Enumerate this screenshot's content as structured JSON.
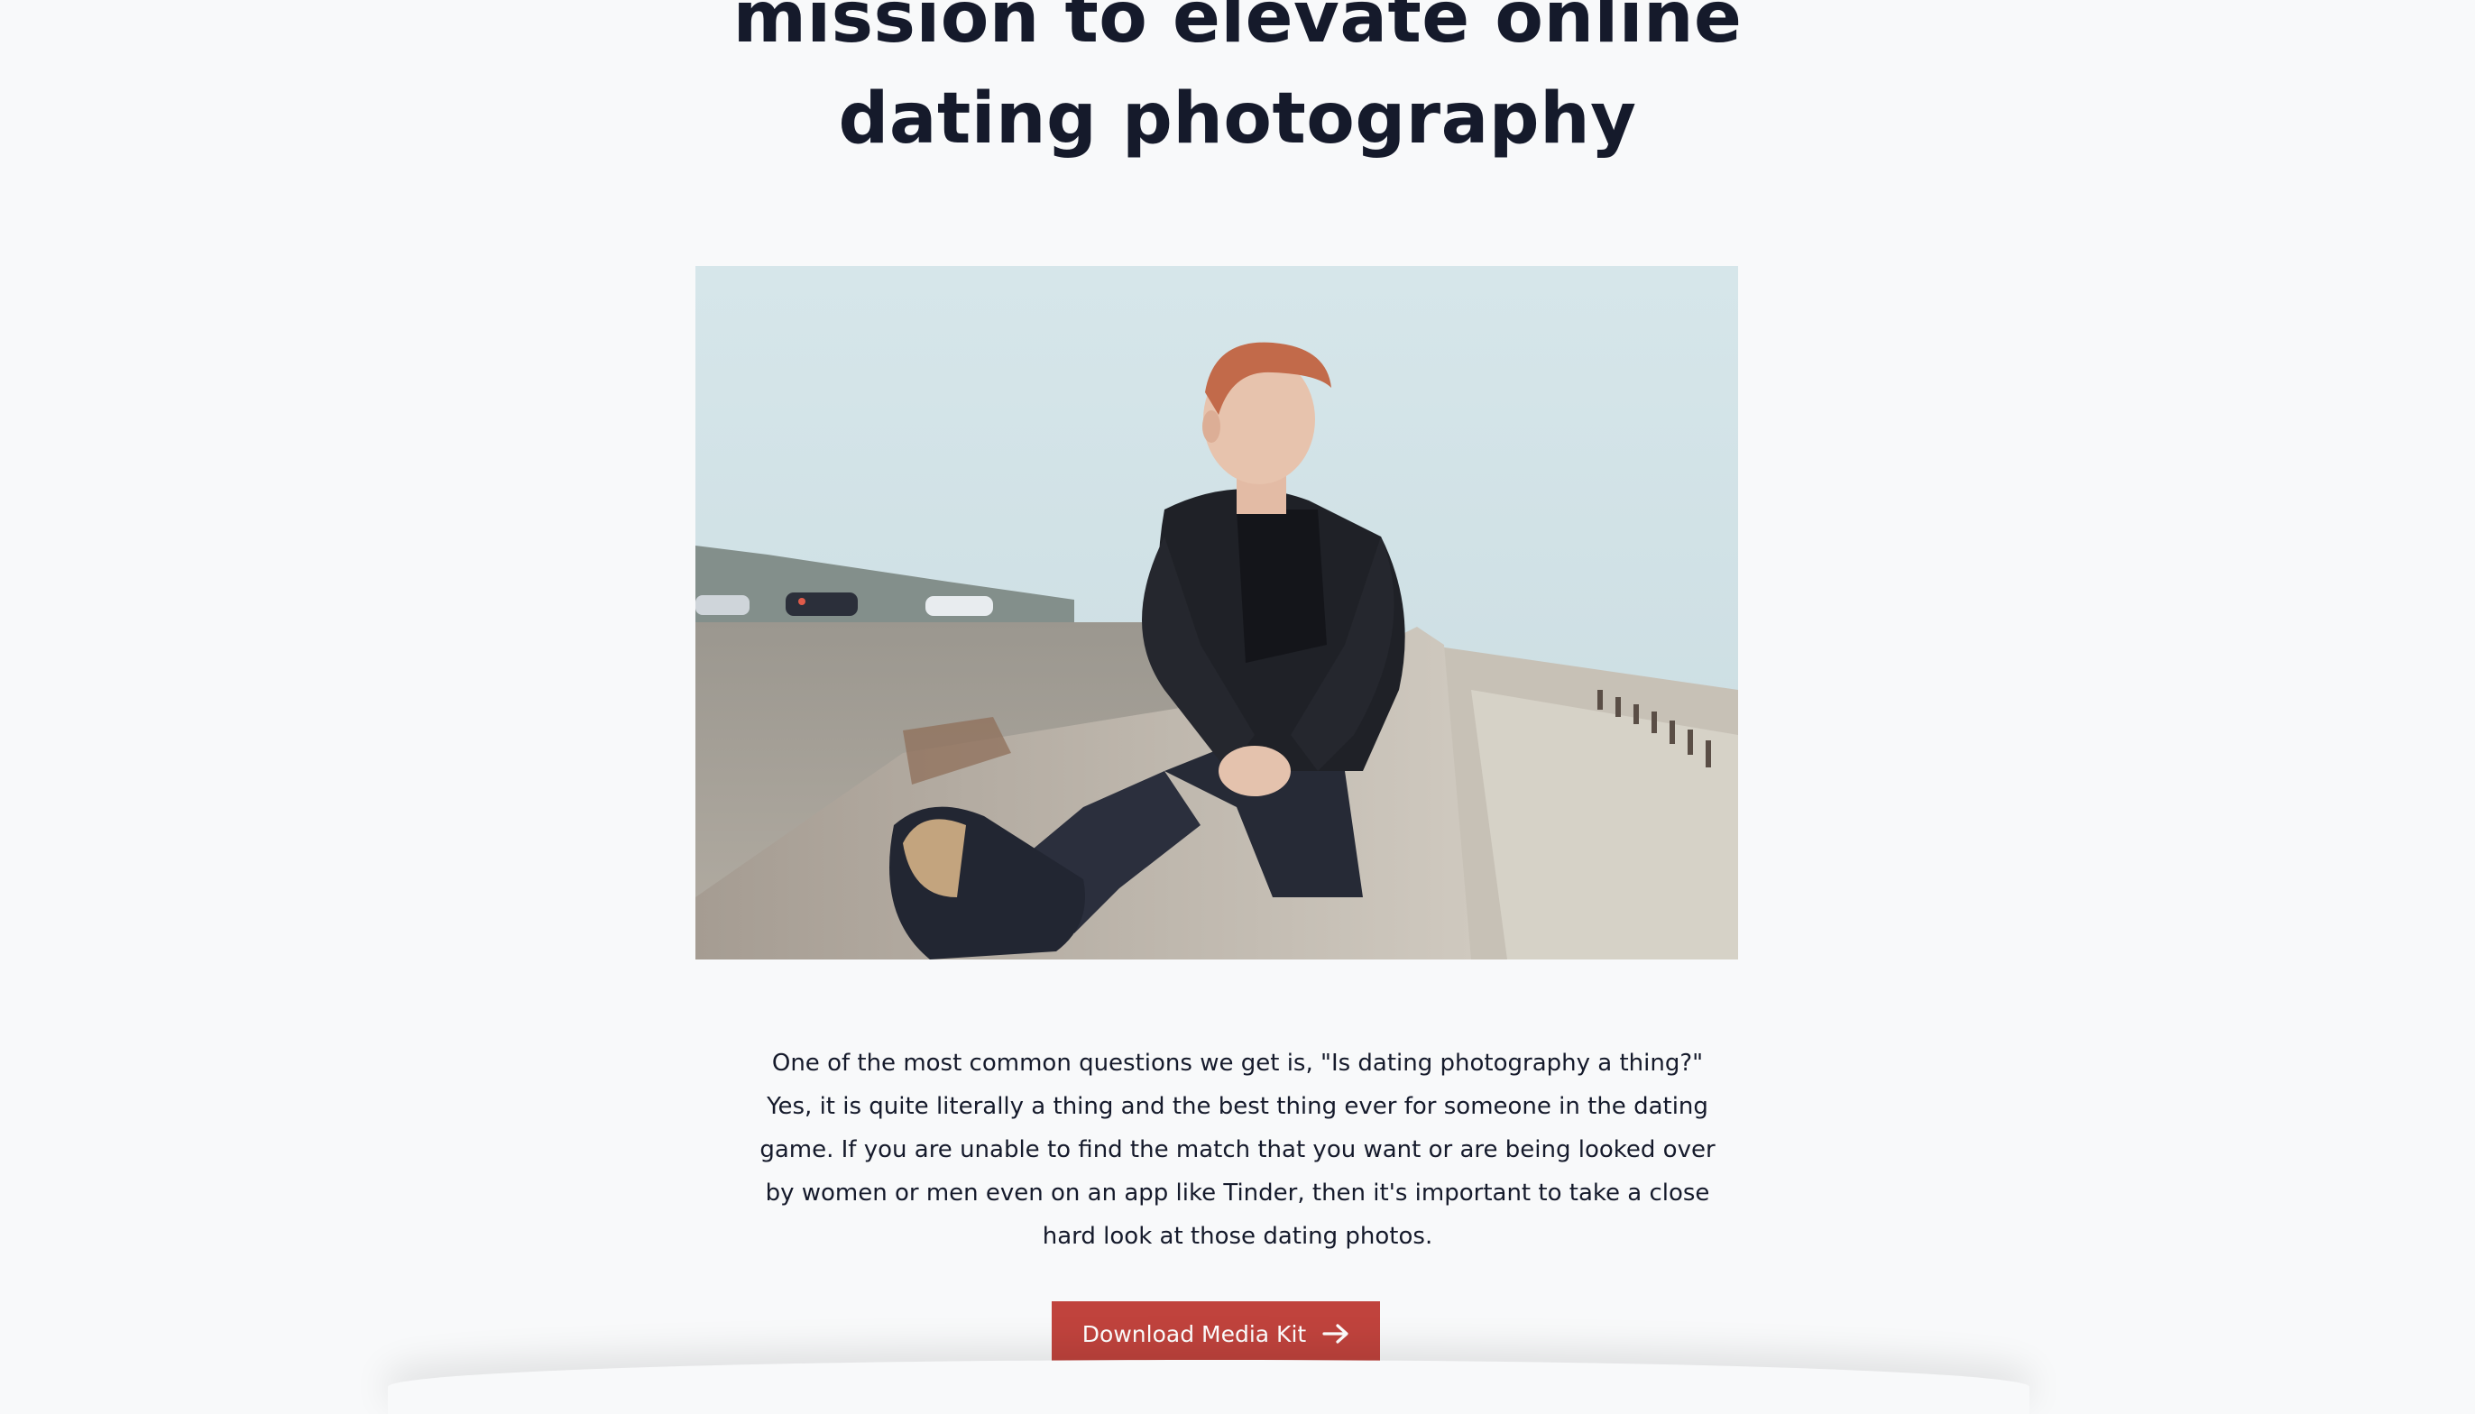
{
  "headline": {
    "line1": "mission to elevate online",
    "line2": "dating photography"
  },
  "hero_image": {
    "icon": "photo-man-sitting-on-seawall",
    "colors": {
      "sky": "#d3e3e7",
      "gravel": "#a8a39b",
      "wall": "#b9b4ab",
      "jacket": "#1f2127",
      "hair": "#c26a4a"
    }
  },
  "body": {
    "lines": [
      "One of the most common questions we get is, \"Is dating photography a thing?\"",
      "Yes, it is quite literally a thing and the best thing ever for someone in the dating",
      "game. If you are unable to find the match that you want or are being looked over",
      "by women or men even on an app like Tinder, then it's important to take a close",
      "hard look at those dating photos."
    ]
  },
  "cta": {
    "label": "Download Media Kit",
    "icon": "arrow-right-icon",
    "color": "#c0433d"
  }
}
